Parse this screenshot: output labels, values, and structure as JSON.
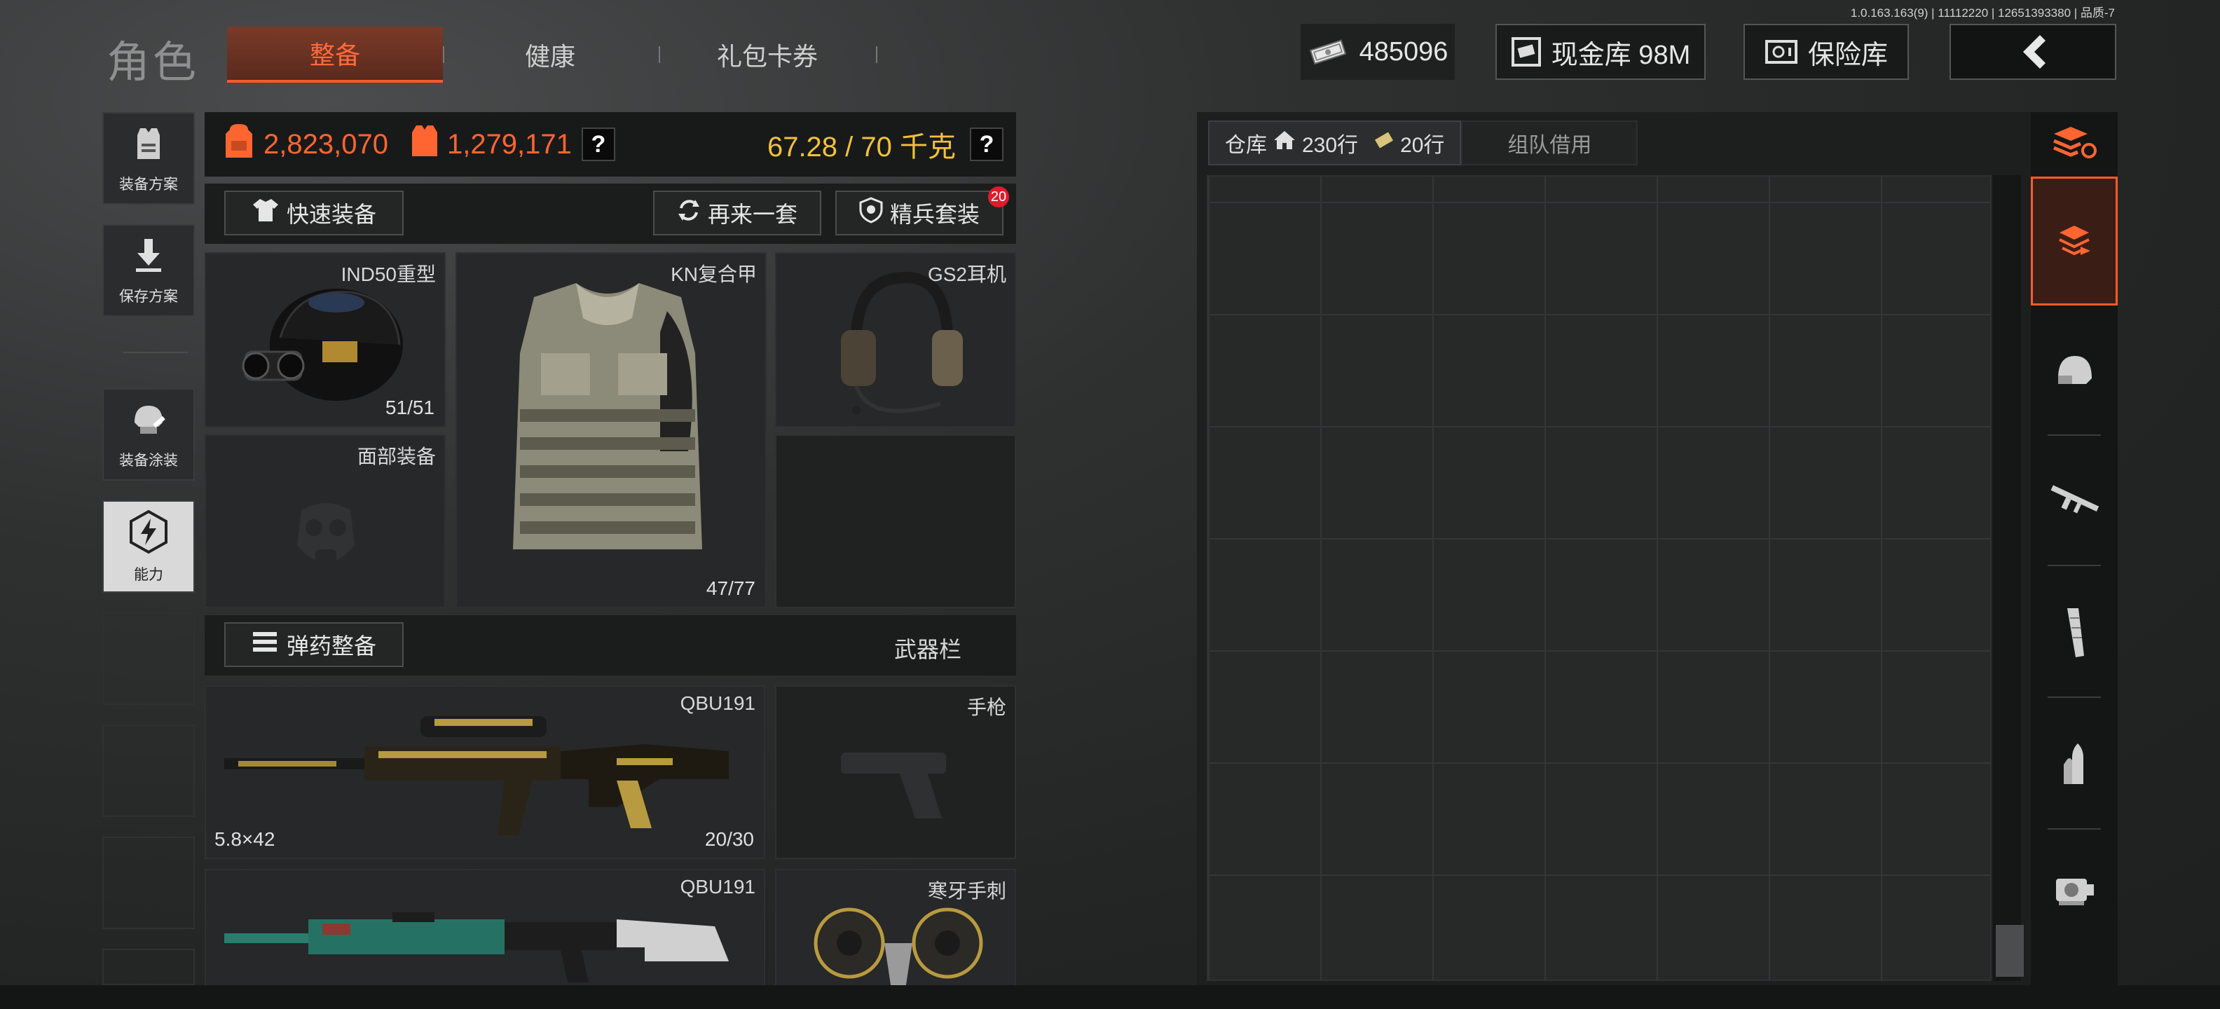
{
  "version": "1.0.163.163(9) | 11112220 | 12651393380 | 品质-7",
  "nav": {
    "title": "角色",
    "tabs": [
      "整备",
      "健康",
      "礼包卡券"
    ],
    "currency": "485096",
    "cash_vault": "现金库 98M",
    "safe": "保险库"
  },
  "sidebar": {
    "items": [
      "装备方案",
      "保存方案",
      "装备涂装",
      "能力"
    ]
  },
  "stats": {
    "value1": "2,823,070",
    "value2": "1,279,171",
    "weight": "67.28 / 70 千克",
    "help": "?"
  },
  "actions": {
    "quick_equip": "快速装备",
    "another_set": "再来一套",
    "elite_set": "精兵套装",
    "elite_badge": "20"
  },
  "slots": {
    "helmet": {
      "name": "IND50重型",
      "dur": "51/51"
    },
    "armor": {
      "name": "KN复合甲",
      "dur": "47/77"
    },
    "headset": {
      "name": "GS2耳机"
    },
    "face": {
      "name": "面部装备"
    }
  },
  "ammo_bar": {
    "button": "弹药整备",
    "label": "武器栏"
  },
  "weapons": {
    "primary": {
      "name": "QBU191",
      "caliber": "5.8×42",
      "ammo": "20/30"
    },
    "pistol": {
      "name": "手枪"
    },
    "secondary": {
      "name": "QBU191"
    },
    "melee": {
      "name": "寒牙手刺"
    }
  },
  "warehouse": {
    "tab_label": "仓库",
    "rows_home": "230行",
    "rows_ticket": "20行",
    "team_borrow": "组队借用"
  },
  "icons": [
    "cash-icon",
    "vault-icon",
    "safe-icon",
    "back-arrow-icon",
    "refresh-layers-icon",
    "stack-icon",
    "helmet-icon",
    "rifle-icon",
    "magazine-icon",
    "bullet-icon",
    "scope-icon"
  ],
  "colors": {
    "accent": "#ff6530",
    "weight": "#f0c23a",
    "badge": "#e01b2b"
  }
}
